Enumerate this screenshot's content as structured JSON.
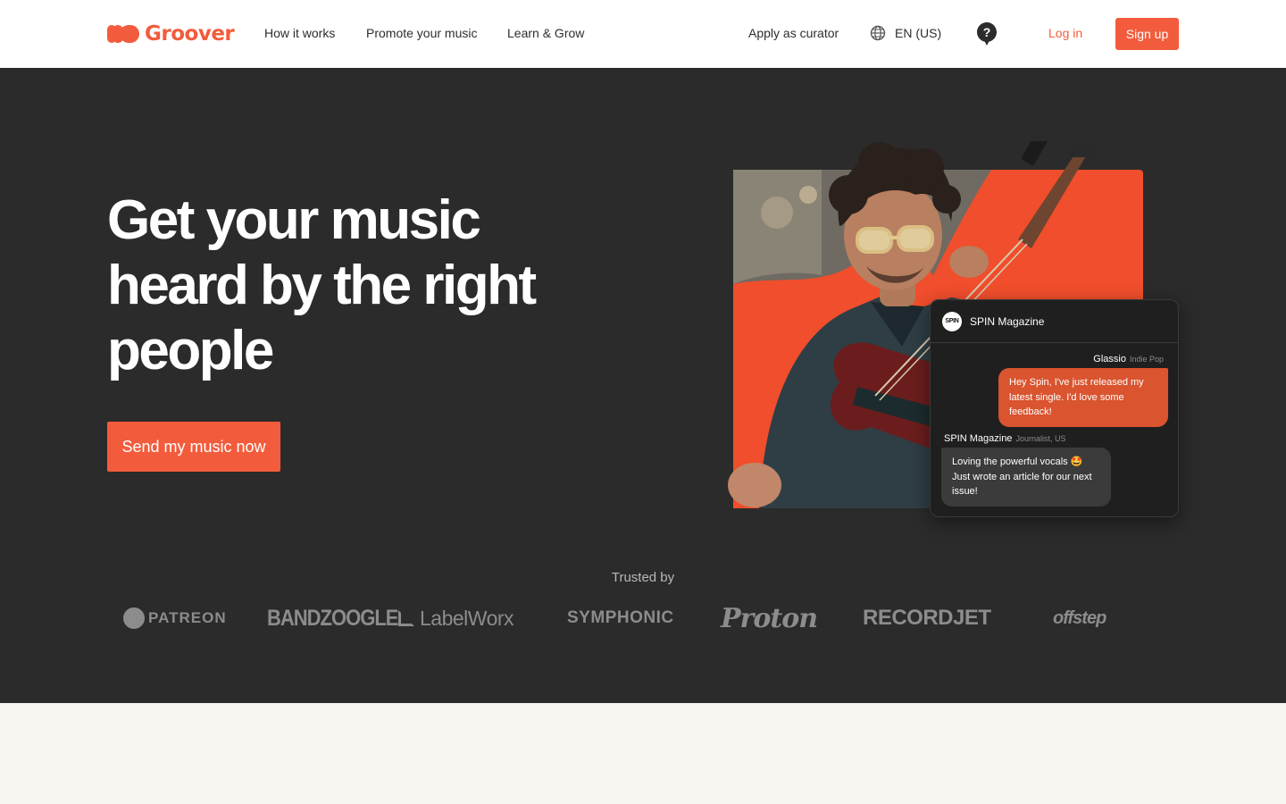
{
  "nav": {
    "brand": "Groover",
    "links": [
      "How it works",
      "Promote your music",
      "Learn & Grow"
    ],
    "apply_curator": "Apply as curator",
    "language": "EN (US)",
    "login": "Log in",
    "signup": "Sign up",
    "accent_color": "#f25c3c"
  },
  "hero": {
    "headline_lines": [
      "Get your music",
      "heard by the right",
      "people"
    ],
    "cta": "Send my music now",
    "background": "#2b2b2b"
  },
  "chat": {
    "outlet": "SPIN Magazine",
    "outlet_logo_text": "SPIN",
    "artist_name": "Glassio",
    "artist_genre": "Indie Pop",
    "artist_message": "Hey Spin, I've just released my latest single. I'd love some feedback!",
    "curator_name": "SPIN Magazine",
    "curator_role": "Journalist, US",
    "curator_message": "Loving the powerful vocals 🤩 Just wrote an article for our next issue!"
  },
  "trusted": {
    "label": "Trusted by",
    "partners": [
      "PATREON",
      "BANDZOOGLE",
      "LabelWorx",
      "SYMPHONIC",
      "Proton",
      "RECORDJET",
      "offstep"
    ]
  }
}
